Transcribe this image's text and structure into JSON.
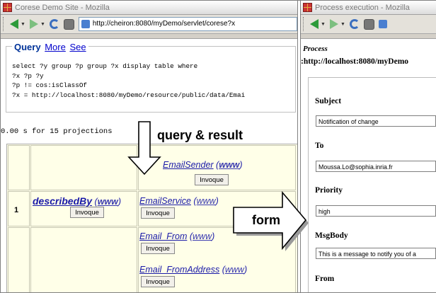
{
  "left_window": {
    "title": "Corese Demo Site - Mozilla",
    "url": "http://cheiron:8080/myDemo/servlet/corese?x",
    "query_legend": {
      "title": "Query",
      "more": "More",
      "see": "See"
    },
    "query_lines": [
      "select ?y group ?p group ?x display table where",
      "?x ?p ?y",
      "?p != cos:isClassOf",
      "?x = http://localhost:8080/myDemo/resource/public/data/Emai"
    ],
    "timing": "0.00 s for 15 projections",
    "results": {
      "header": {
        "label": "EmailSender",
        "www": "www",
        "button": "Invoque"
      },
      "row_number": "1",
      "row_label": {
        "label": "describedBy",
        "www": "www",
        "button": "Invoque"
      },
      "values": [
        {
          "label": "EmailService",
          "www": "www",
          "button": "Invoque"
        },
        {
          "label": "Email_From",
          "www": "www",
          "button": "Invoque"
        },
        {
          "label": "Email_FromAddress",
          "www": "www",
          "button": "Invoque"
        }
      ]
    }
  },
  "right_window": {
    "title": "Process execution - Mozilla",
    "process_label": "Process",
    "process_url": ":http://localhost:8080/myDemo",
    "fields": [
      {
        "label": "Subject",
        "value": "Notification of change"
      },
      {
        "label": "To",
        "value": "Moussa.Lo@sophia.inria.fr"
      },
      {
        "label": "Priority",
        "value": "high"
      },
      {
        "label": "MsgBody",
        "value": "This is a message to notify you of a"
      },
      {
        "label": "From",
        "value": ""
      }
    ]
  },
  "annotations": {
    "query_result": "query & result",
    "form": "form"
  }
}
